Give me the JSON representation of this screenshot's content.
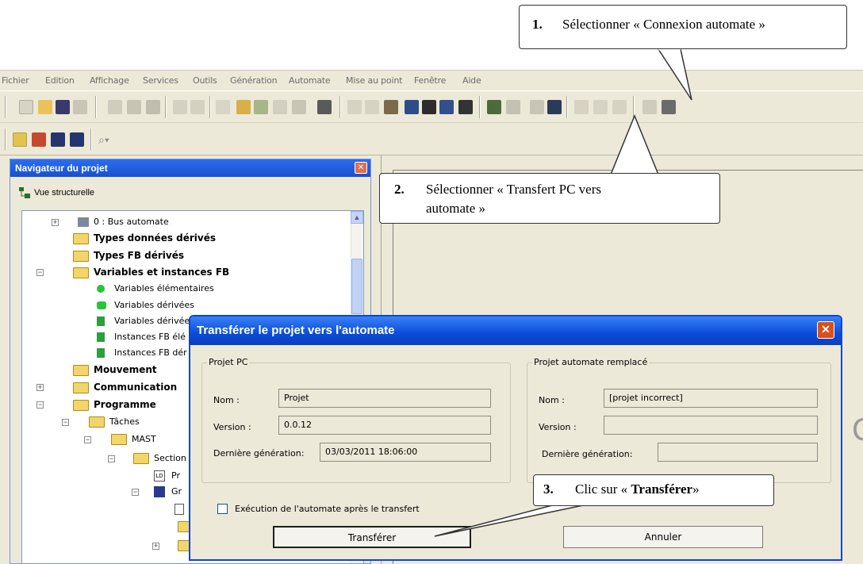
{
  "menu": [
    "Fichier",
    "Edition",
    "Affichage",
    "Services",
    "Outils",
    "Génération",
    "Automate",
    "Mise au point",
    "Fenêtre",
    "Aide"
  ],
  "navigator": {
    "title": "Navigateur du projet",
    "view_label": "Vue structurelle",
    "tree": [
      "0 : Bus automate",
      "Types données dérivés",
      "Types FB dérivés",
      "Variables et instances FB",
      "Variables élémentaires",
      "Variables dérivées",
      "Variables dérivée",
      "Instances FB élé",
      "Instances FB dér",
      "Mouvement",
      "Communication",
      "Programme",
      "Tâches",
      "MAST",
      "Section",
      "Pr",
      "Gr"
    ]
  },
  "dialog": {
    "title": "Transférer le projet vers l'automate",
    "pc_group": "Projet PC",
    "plc_group": "Projet automate remplacé",
    "name_label": "Nom :",
    "version_label": "Version :",
    "last_gen_label": "Dernière génération:",
    "pc_name": "Projet",
    "pc_version": "0.0.12",
    "pc_last_gen": "03/03/2011 18:06:00",
    "plc_name": "[projet incorrect]",
    "plc_version": "",
    "plc_last_gen": "",
    "run_after_label": "Exécution de l'automate après le transfert",
    "transfer_button": "Transférer",
    "cancel_button": "Annuler"
  },
  "callouts": {
    "c1_num": "1.",
    "c1_text": "Sélectionner « Connexion automate »",
    "c2_num": "2.",
    "c2_text_line1": "Sélectionner « Transfert PC vers",
    "c2_text_line2": "automate »",
    "c3_num": "3.",
    "c3_text_pre": "Clic sur « ",
    "c3_text_bold": "Transférer",
    "c3_text_post": "»"
  },
  "colors": {
    "titlebar": "#0b4bd9",
    "panel": "#ece9d8",
    "close": "#d9501c"
  }
}
